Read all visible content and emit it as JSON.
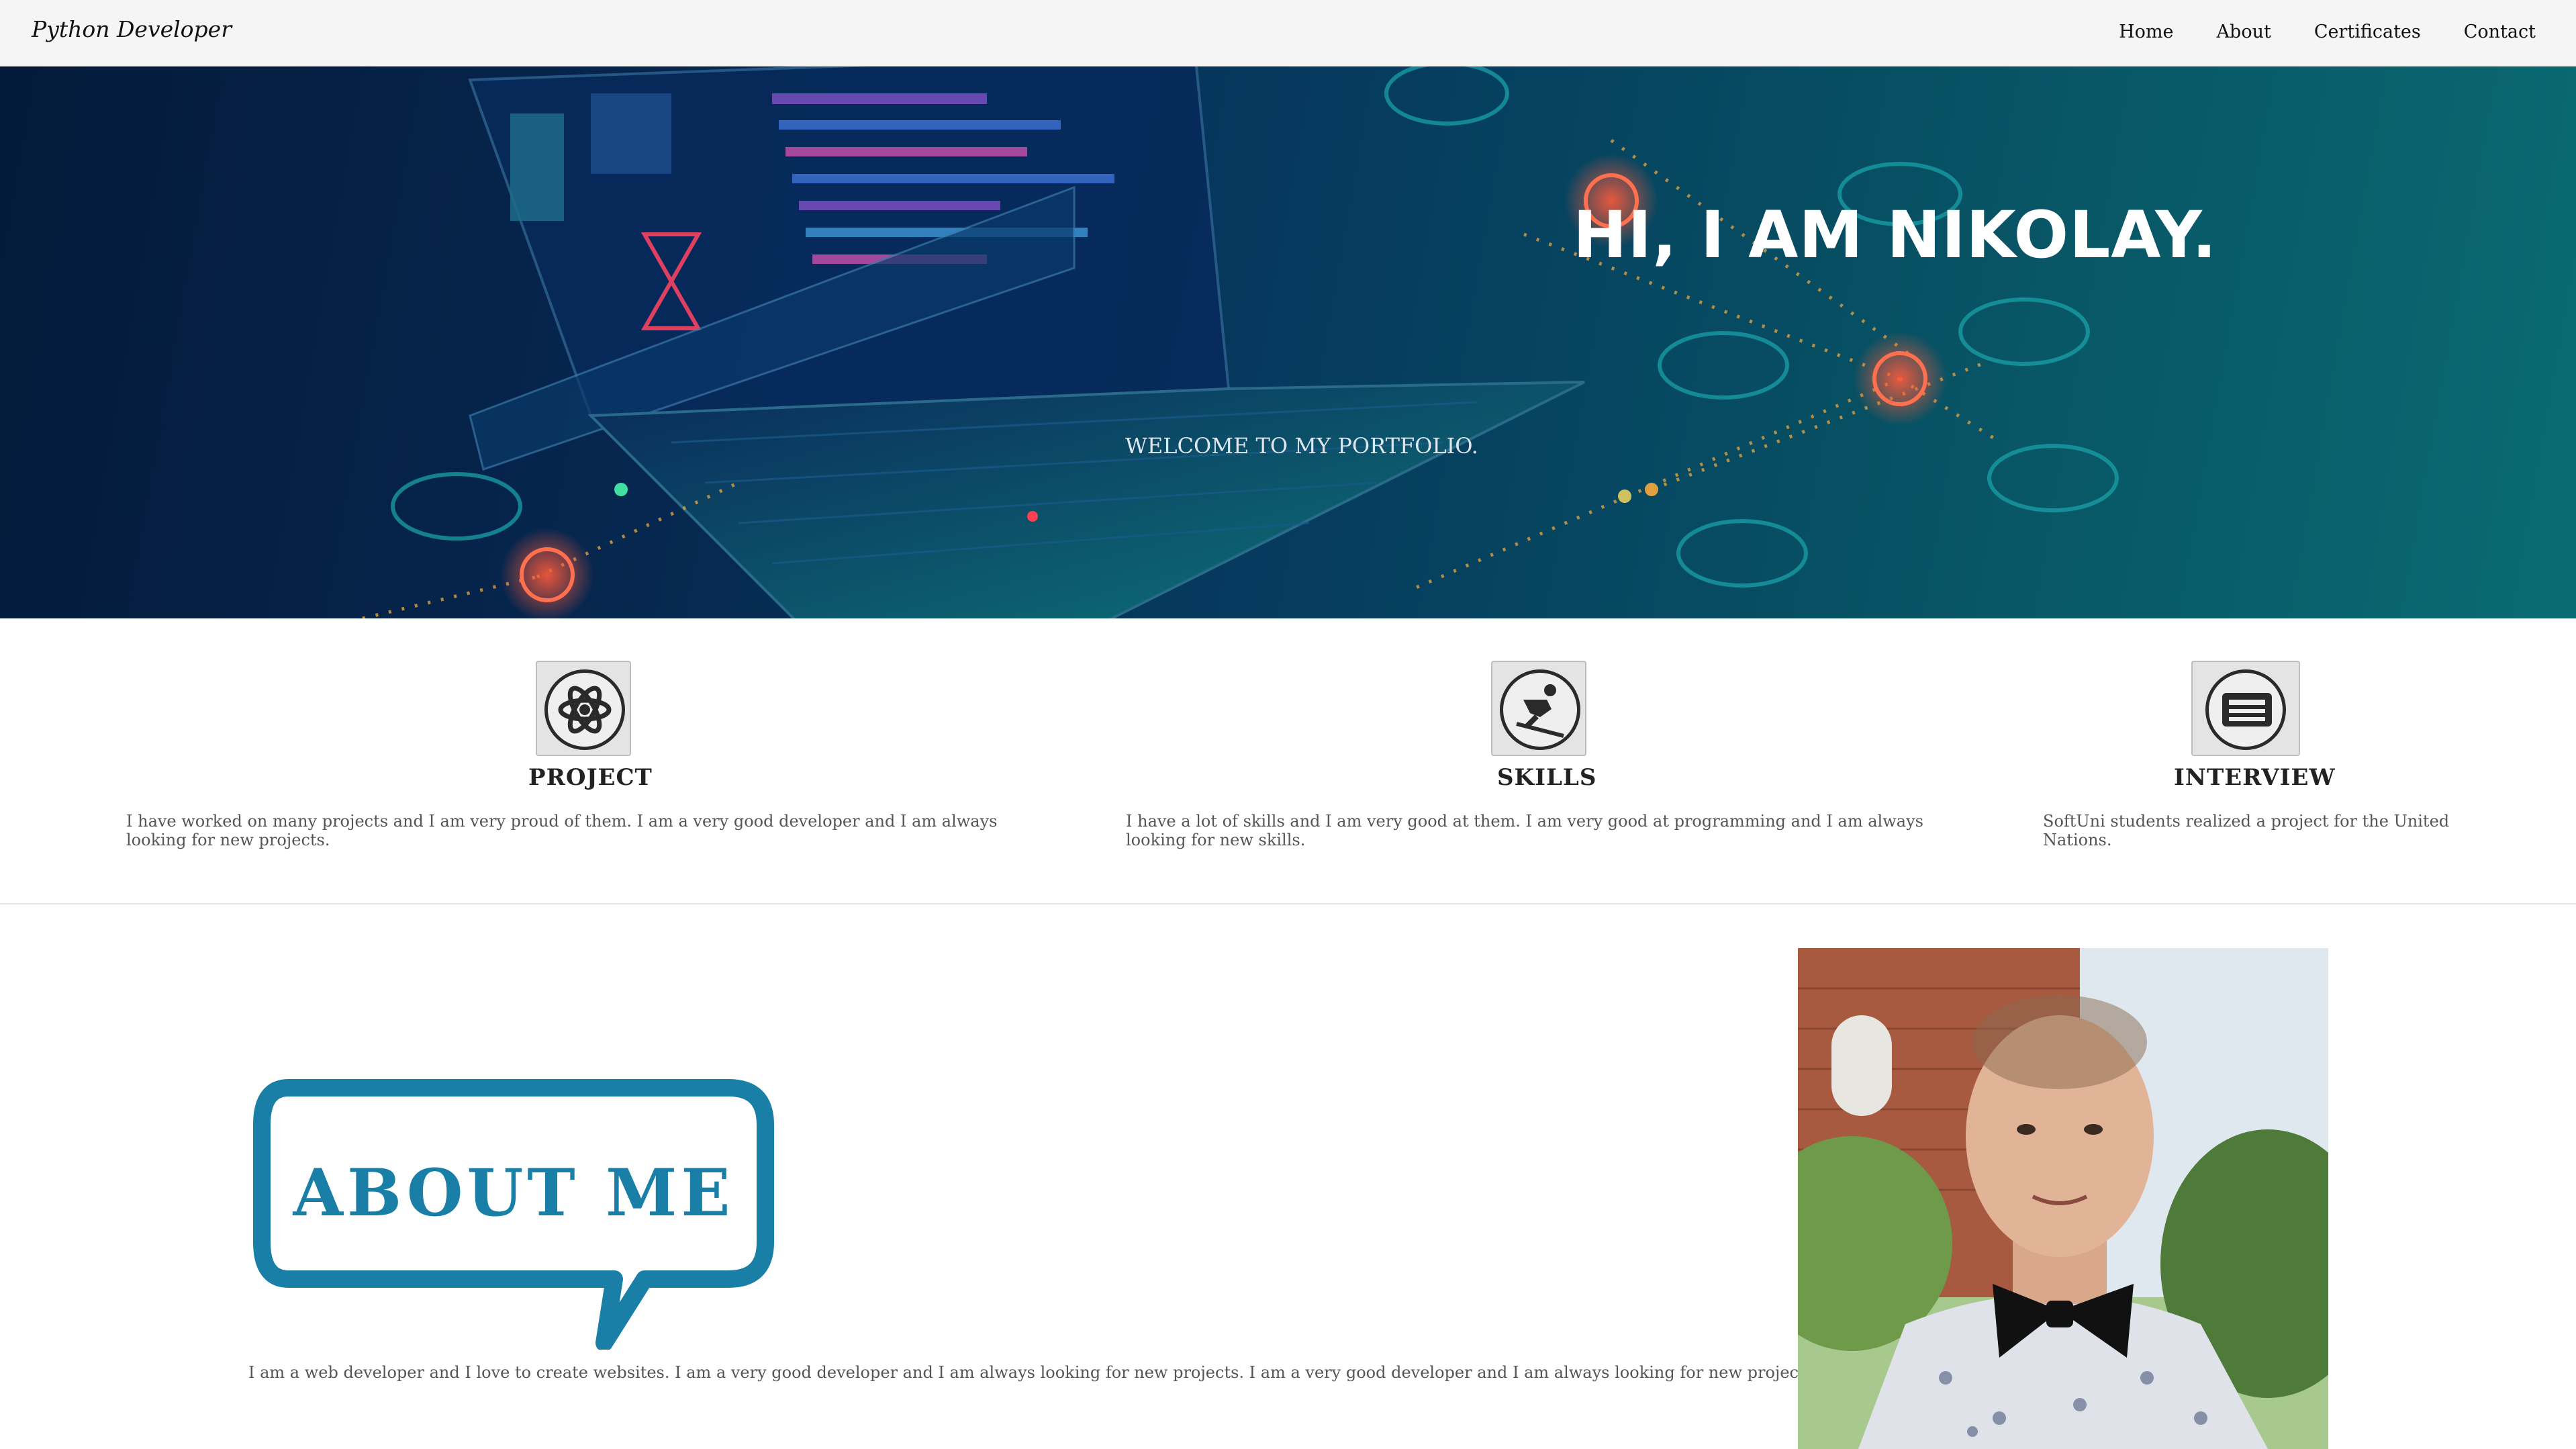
{
  "navbar": {
    "brand": "Python Developer",
    "links": [
      "Home",
      "About",
      "Certificates",
      "Contact"
    ]
  },
  "hero": {
    "title": "HI, I AM NIKOLAY.",
    "subtitle": "WELCOME TO MY PORTFOLIO."
  },
  "features": [
    {
      "icon": "atom-icon",
      "title": "PROJECT",
      "text_lines": [
        "I have worked on many projects and I am very proud of them. I am a very good developer and I am always",
        "looking for new projects."
      ]
    },
    {
      "icon": "skier-icon",
      "title": "SKILLS",
      "text_lines": [
        "I have a lot of skills and I am very good at them. I am very good at programming and I am always",
        "looking for new skills."
      ]
    },
    {
      "icon": "newspaper-icon",
      "title": "INTERVIEW",
      "text_lines": [
        "SoftUni students realized a project for the United",
        "Nations."
      ]
    }
  ],
  "about": {
    "heading": "ABOUT ME",
    "text": "I am a web developer and I love to create websites. I am a very good developer and I am always looking for new projects. I am a very good developer and I am always looking for new projects."
  },
  "colors": {
    "hero_dark": "#041a3a",
    "hero_teal": "#0a6b72",
    "about_blue": "#1a7fa6",
    "navbar_bg": "#f5f5f5"
  }
}
